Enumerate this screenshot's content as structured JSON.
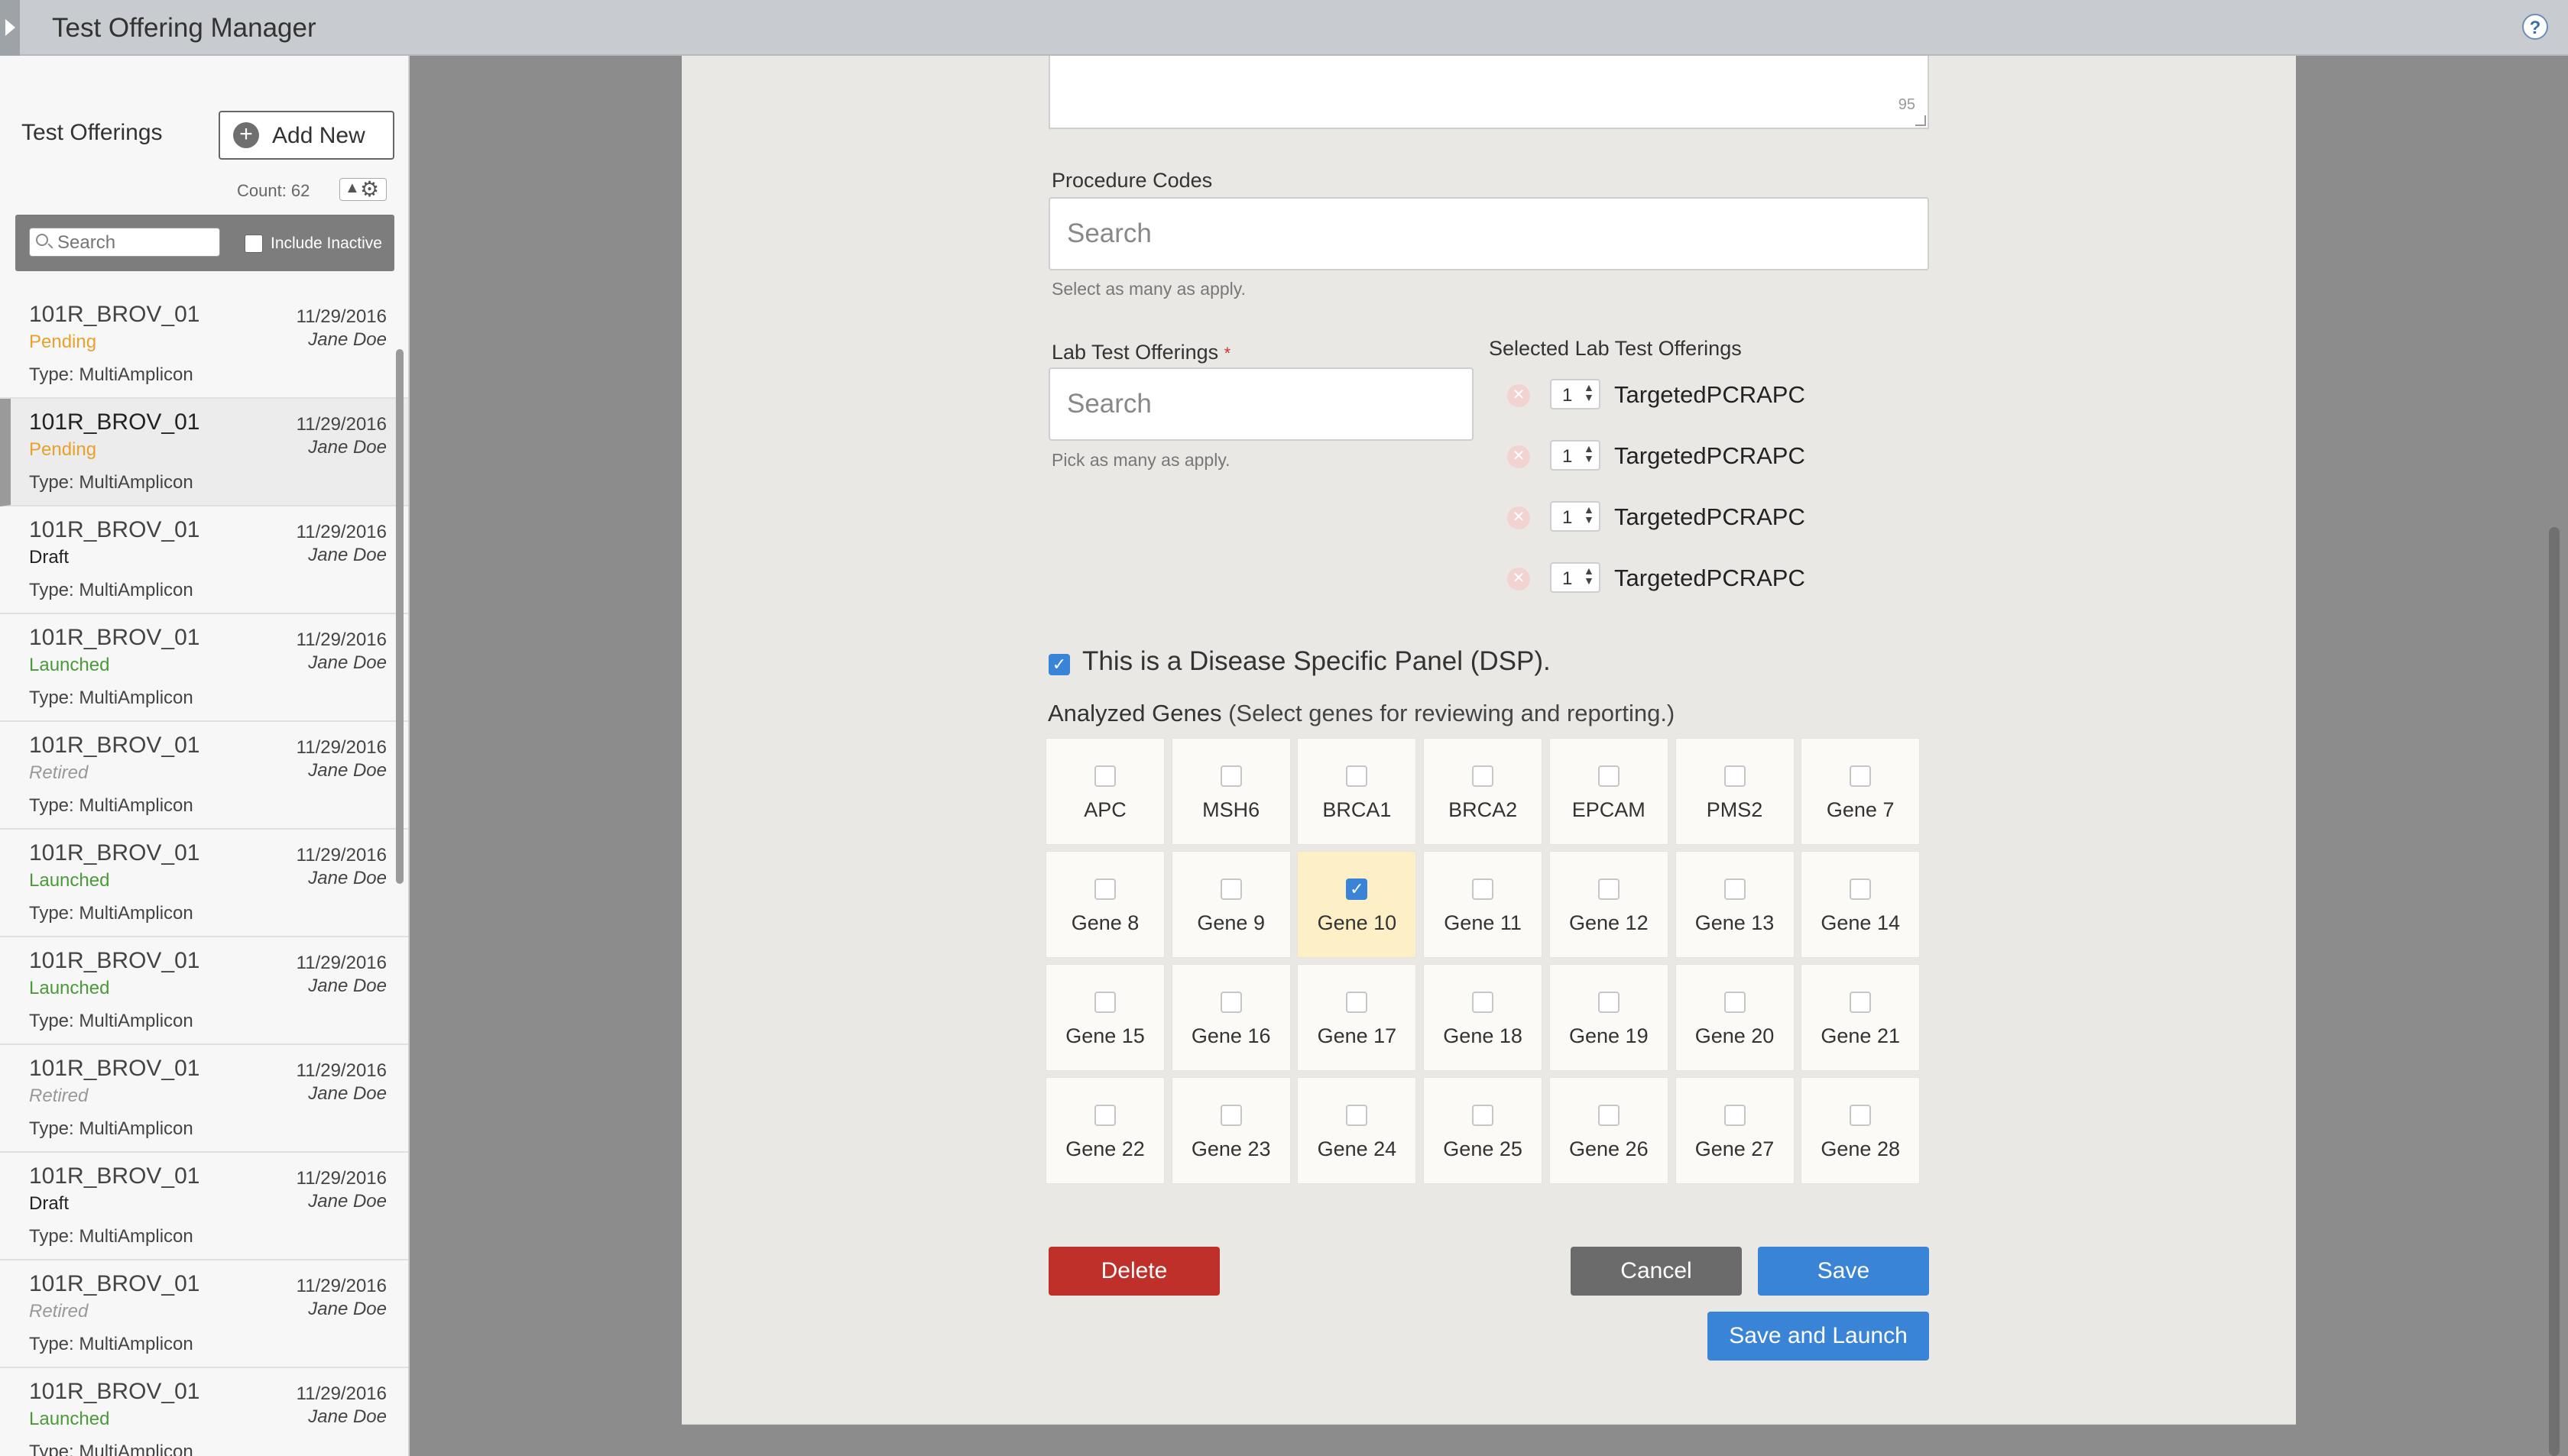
{
  "app": {
    "title": "Test Offering Manager",
    "help_label": "?"
  },
  "sidebar": {
    "title": "Test Offerings",
    "add_new_label": "Add New",
    "count_label": "Count: 62",
    "search_placeholder": "Search",
    "include_inactive_label": "Include Inactive",
    "items": [
      {
        "name": "101R_BROV_01",
        "status": "Pending",
        "type": "Type: MultiAmplicon",
        "date": "11/29/2016",
        "user": "Jane Doe"
      },
      {
        "name": "101R_BROV_01",
        "status": "Pending",
        "type": "Type: MultiAmplicon",
        "date": "11/29/2016",
        "user": "Jane Doe"
      },
      {
        "name": "101R_BROV_01",
        "status": "Draft",
        "type": "Type: MultiAmplicon",
        "date": "11/29/2016",
        "user": "Jane Doe"
      },
      {
        "name": "101R_BROV_01",
        "status": "Launched",
        "type": "Type: MultiAmplicon",
        "date": "11/29/2016",
        "user": "Jane Doe"
      },
      {
        "name": "101R_BROV_01",
        "status": "Retired",
        "type": "Type: MultiAmplicon",
        "date": "11/29/2016",
        "user": "Jane Doe"
      },
      {
        "name": "101R_BROV_01",
        "status": "Launched",
        "type": "Type: MultiAmplicon",
        "date": "11/29/2016",
        "user": "Jane Doe"
      },
      {
        "name": "101R_BROV_01",
        "status": "Launched",
        "type": "Type: MultiAmplicon",
        "date": "11/29/2016",
        "user": "Jane Doe"
      },
      {
        "name": "101R_BROV_01",
        "status": "Retired",
        "type": "Type: MultiAmplicon",
        "date": "11/29/2016",
        "user": "Jane Doe"
      },
      {
        "name": "101R_BROV_01",
        "status": "Draft",
        "type": "Type: MultiAmplicon",
        "date": "11/29/2016",
        "user": "Jane Doe"
      },
      {
        "name": "101R_BROV_01",
        "status": "Retired",
        "type": "Type: MultiAmplicon",
        "date": "11/29/2016",
        "user": "Jane Doe"
      },
      {
        "name": "101R_BROV_01",
        "status": "Launched",
        "type": "Type: MultiAmplicon",
        "date": "11/29/2016",
        "user": "Jane Doe"
      }
    ]
  },
  "form": {
    "description_count": "95",
    "procedure_codes": {
      "label": "Procedure Codes",
      "placeholder": "Search",
      "help": "Select as many as apply."
    },
    "lab_tests": {
      "label": "Lab Test Offerings",
      "required_mark": "*",
      "placeholder": "Search",
      "help": "Pick as many as apply."
    },
    "selected_lab_tests": {
      "label": "Selected Lab Test Offerings",
      "items": [
        {
          "qty": "1",
          "name": "TargetedPCRAPC"
        },
        {
          "qty": "1",
          "name": "TargetedPCRAPC"
        },
        {
          "qty": "1",
          "name": "TargetedPCRAPC"
        },
        {
          "qty": "1",
          "name": "TargetedPCRAPC"
        }
      ]
    },
    "dsp_label": "This is a Disease Specific Panel (DSP).",
    "dsp_checked": true,
    "genes": {
      "label": "Analyzed Genes",
      "sublabel": "(Select genes for reviewing and reporting.)",
      "items": [
        {
          "name": "APC",
          "checked": false
        },
        {
          "name": "MSH6",
          "checked": false
        },
        {
          "name": "BRCA1",
          "checked": false
        },
        {
          "name": "BRCA2",
          "checked": false
        },
        {
          "name": "EPCAM",
          "checked": false
        },
        {
          "name": "PMS2",
          "checked": false
        },
        {
          "name": "Gene 7",
          "checked": false
        },
        {
          "name": "Gene 8",
          "checked": false
        },
        {
          "name": "Gene 9",
          "checked": false
        },
        {
          "name": "Gene 10",
          "checked": true
        },
        {
          "name": "Gene 11",
          "checked": false
        },
        {
          "name": "Gene 12",
          "checked": false
        },
        {
          "name": "Gene 13",
          "checked": false
        },
        {
          "name": "Gene 14",
          "checked": false
        },
        {
          "name": "Gene 15",
          "checked": false
        },
        {
          "name": "Gene 16",
          "checked": false
        },
        {
          "name": "Gene 17",
          "checked": false
        },
        {
          "name": "Gene 18",
          "checked": false
        },
        {
          "name": "Gene 19",
          "checked": false
        },
        {
          "name": "Gene 20",
          "checked": false
        },
        {
          "name": "Gene 21",
          "checked": false
        },
        {
          "name": "Gene 22",
          "checked": false
        },
        {
          "name": "Gene 23",
          "checked": false
        },
        {
          "name": "Gene 24",
          "checked": false
        },
        {
          "name": "Gene 25",
          "checked": false
        },
        {
          "name": "Gene 26",
          "checked": false
        },
        {
          "name": "Gene 27",
          "checked": false
        },
        {
          "name": "Gene 28",
          "checked": false
        }
      ]
    },
    "buttons": {
      "delete": "Delete",
      "cancel": "Cancel",
      "save": "Save",
      "save_launch": "Save and Launch"
    }
  },
  "colors": {
    "pending": "#e8a12a",
    "launched": "#4a9a3a",
    "retired": "#999999",
    "draft": "#222222",
    "primary": "#3a84d8",
    "danger": "#c0302a",
    "neutral": "#6b6b6b"
  }
}
